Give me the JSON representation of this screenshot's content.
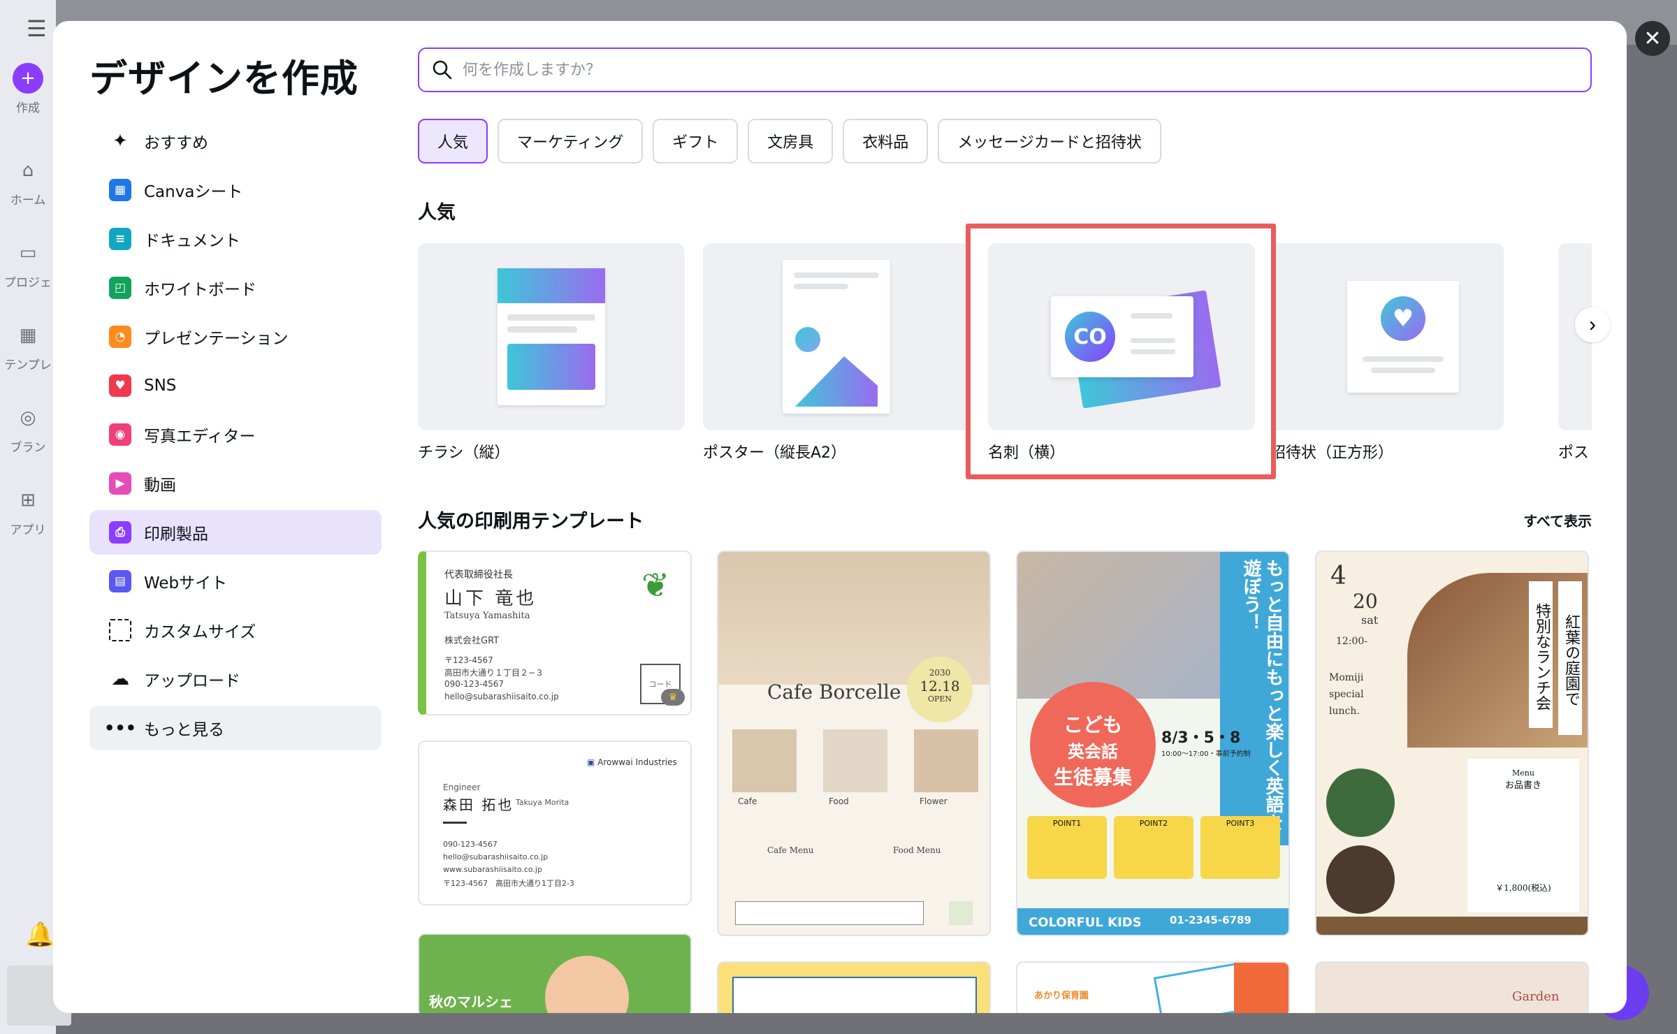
{
  "modal": {
    "title": "デザインを作成"
  },
  "background": {
    "rail": [
      {
        "label": "作成"
      },
      {
        "label": "ホーム"
      },
      {
        "label": "プロジェ"
      },
      {
        "label": "テンプレ"
      },
      {
        "label": "ブラン"
      },
      {
        "label": "アプリ"
      }
    ]
  },
  "sidebar": {
    "items": [
      {
        "label": "おすすめ",
        "icon": "sparkle-icon"
      },
      {
        "label": "Canvaシート",
        "icon": "sheets-icon",
        "color": "#1f76e5"
      },
      {
        "label": "ドキュメント",
        "icon": "doc-icon",
        "color": "#12a7c1"
      },
      {
        "label": "ホワイトボード",
        "icon": "whiteboard-icon",
        "color": "#12a25d"
      },
      {
        "label": "プレゼンテーション",
        "icon": "presentation-icon",
        "color": "#ff8a1d"
      },
      {
        "label": "SNS",
        "icon": "heart-icon",
        "color": "#f0384f"
      },
      {
        "label": "写真エディター",
        "icon": "camera-icon",
        "color": "#ef3f7a"
      },
      {
        "label": "動画",
        "icon": "video-icon",
        "color": "#e64cb7"
      },
      {
        "label": "印刷製品",
        "icon": "printer-icon",
        "color": "#8b3dff"
      },
      {
        "label": "Webサイト",
        "icon": "website-icon",
        "color": "#5a58f2"
      },
      {
        "label": "カスタムサイズ",
        "icon": "resize-icon"
      },
      {
        "label": "アップロード",
        "icon": "upload-cloud-icon"
      },
      {
        "label": "もっと見る",
        "icon": "more-dots-icon"
      }
    ]
  },
  "search": {
    "placeholder": "何を作成しますか？"
  },
  "chips": [
    {
      "label": "人気"
    },
    {
      "label": "マーケティング"
    },
    {
      "label": "ギフト"
    },
    {
      "label": "文房具"
    },
    {
      "label": "衣料品"
    },
    {
      "label": "メッセージカードと招待状"
    }
  ],
  "popular": {
    "title": "人気",
    "items": [
      {
        "label": "チラシ（縦）"
      },
      {
        "label": "ポスター（縦長A2）"
      },
      {
        "label": "名刺（横）",
        "logo_text": "CO"
      },
      {
        "label": "招待状（正方形）"
      },
      {
        "label": "ポス"
      }
    ]
  },
  "print_templates": {
    "title": "人気の印刷用テンプレート",
    "see_all": "すべて表示",
    "card1": {
      "role": "代表取締役社長",
      "name": "山下 竜也",
      "roman": "Tatsuya Yamashita",
      "company": "株式会社GRT",
      "postal": "〒123-4567",
      "address": "高田市大通り１丁目２−３",
      "phone": "090-123-4567",
      "email": "hello@subarashiisaito.co.jp",
      "code": "コード"
    },
    "card2": {
      "company": "Arowwai Industries",
      "role": "Engineer",
      "name": "森田 拓也",
      "roman": "Takuya Morita",
      "phone": "090-123-4567",
      "email": "hello@subarashiisaito.co.jp",
      "web": "www.subarashiisaito.co.jp",
      "address": "〒123-4567　高田市大通り1丁目2-3"
    },
    "card3": {
      "title": "Cafe Borcelle",
      "year": "2030",
      "date": "12.18",
      "open": "OPEN",
      "labels": [
        "Cafe",
        "Food",
        "Flower"
      ],
      "menu1": "Cafe Menu",
      "menu2": "Food Menu"
    },
    "card4": {
      "vertical": "もっと自由にもっと楽しく英語を遊ぼう！",
      "circle_top": "こども",
      "circle_mid": "英会話",
      "circle_bottom": "生徒募集",
      "date": "8/3・5・8",
      "time": "10:00〜17:00・事前予約制",
      "points": [
        "POINT1",
        "POINT2",
        "POINT3"
      ],
      "footer": "COLORFUL KIDS",
      "phone": "01-2345-6789"
    },
    "card5": {
      "month": "4",
      "day": "20",
      "dow": "sat",
      "time": "12:00-",
      "en1": "Momiji",
      "en2": "special",
      "en3": "lunch.",
      "vertical1": "紅葉の庭園で",
      "vertical2": "特別なランチ会",
      "menu_title": "Menu",
      "menu_sub": "お品書き",
      "price": "￥1,800(税込)"
    },
    "row3": {
      "card1_text": "秋のマルシェ",
      "card3_text": "あかり保育園",
      "card4_text": "Garden"
    }
  },
  "colors": {
    "accent": "#8b3dff",
    "highlight": "#ea5c5c"
  }
}
